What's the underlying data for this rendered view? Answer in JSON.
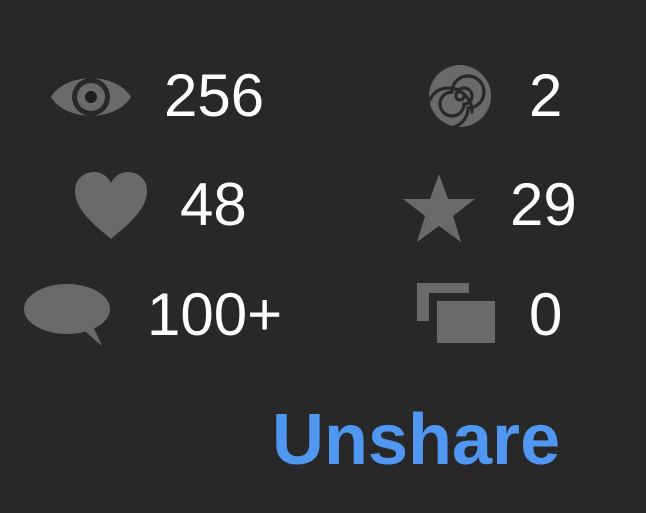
{
  "stats": {
    "views": {
      "icon": "eye-icon",
      "value": "256"
    },
    "spirals": {
      "icon": "spiral-icon",
      "value": "2"
    },
    "likes": {
      "icon": "heart-icon",
      "value": "48"
    },
    "favorites": {
      "icon": "star-icon",
      "value": "29"
    },
    "comments": {
      "icon": "speech-bubble-icon",
      "value": "100+"
    },
    "copies": {
      "icon": "copies-icon",
      "value": "0"
    }
  },
  "actions": {
    "unshare_label": "Unshare"
  },
  "colors": {
    "background": "#282828",
    "icon": "#6a6a6a",
    "value_text": "#ffffff",
    "link": "#4f97f0"
  }
}
